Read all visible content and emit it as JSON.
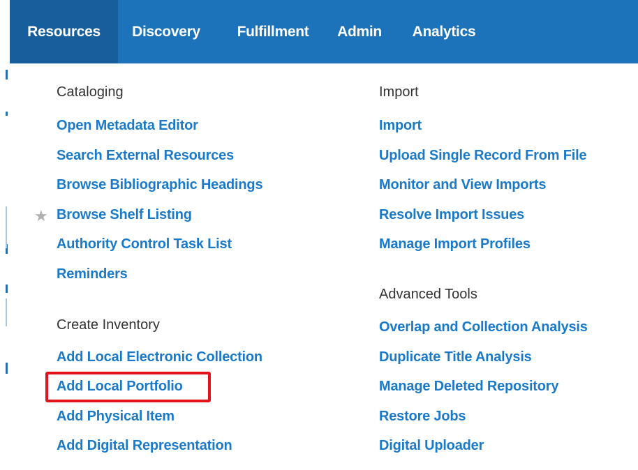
{
  "nav": {
    "items": [
      {
        "label": "Resources",
        "active": true
      },
      {
        "label": "Discovery",
        "active": false
      },
      {
        "label": "Fulfillment",
        "active": false
      },
      {
        "label": "Admin",
        "active": false
      },
      {
        "label": "Analytics",
        "active": false
      }
    ]
  },
  "menu": {
    "cataloging": {
      "heading": "Cataloging",
      "items": [
        "Open Metadata Editor",
        "Search External Resources",
        "Browse Bibliographic Headings",
        "Browse Shelf Listing",
        "Authority Control Task List",
        "Reminders"
      ],
      "starred_item": "Browse Shelf Listing"
    },
    "create_inventory": {
      "heading": "Create Inventory",
      "items": [
        "Add Local Electronic Collection",
        "Add Local Portfolio",
        "Add Physical Item",
        "Add Digital Representation"
      ],
      "highlighted_item": "Add Local Portfolio"
    },
    "import": {
      "heading": "Import",
      "items": [
        "Import",
        "Upload Single Record From File",
        "Monitor and View Imports",
        "Resolve Import Issues",
        "Manage Import Profiles"
      ]
    },
    "advanced_tools": {
      "heading": "Advanced Tools",
      "items": [
        "Overlap and Collection Analysis",
        "Duplicate Title Analysis",
        "Manage Deleted Repository",
        "Restore Jobs",
        "Digital Uploader"
      ]
    }
  },
  "colors": {
    "navbar": "#1c73b9",
    "navbar_active": "#175f9c",
    "link": "#1a7ac9",
    "heading": "#333333",
    "highlight": "#e3121b",
    "star": "#b0b0b0"
  },
  "icons": {
    "star": "star-icon"
  }
}
